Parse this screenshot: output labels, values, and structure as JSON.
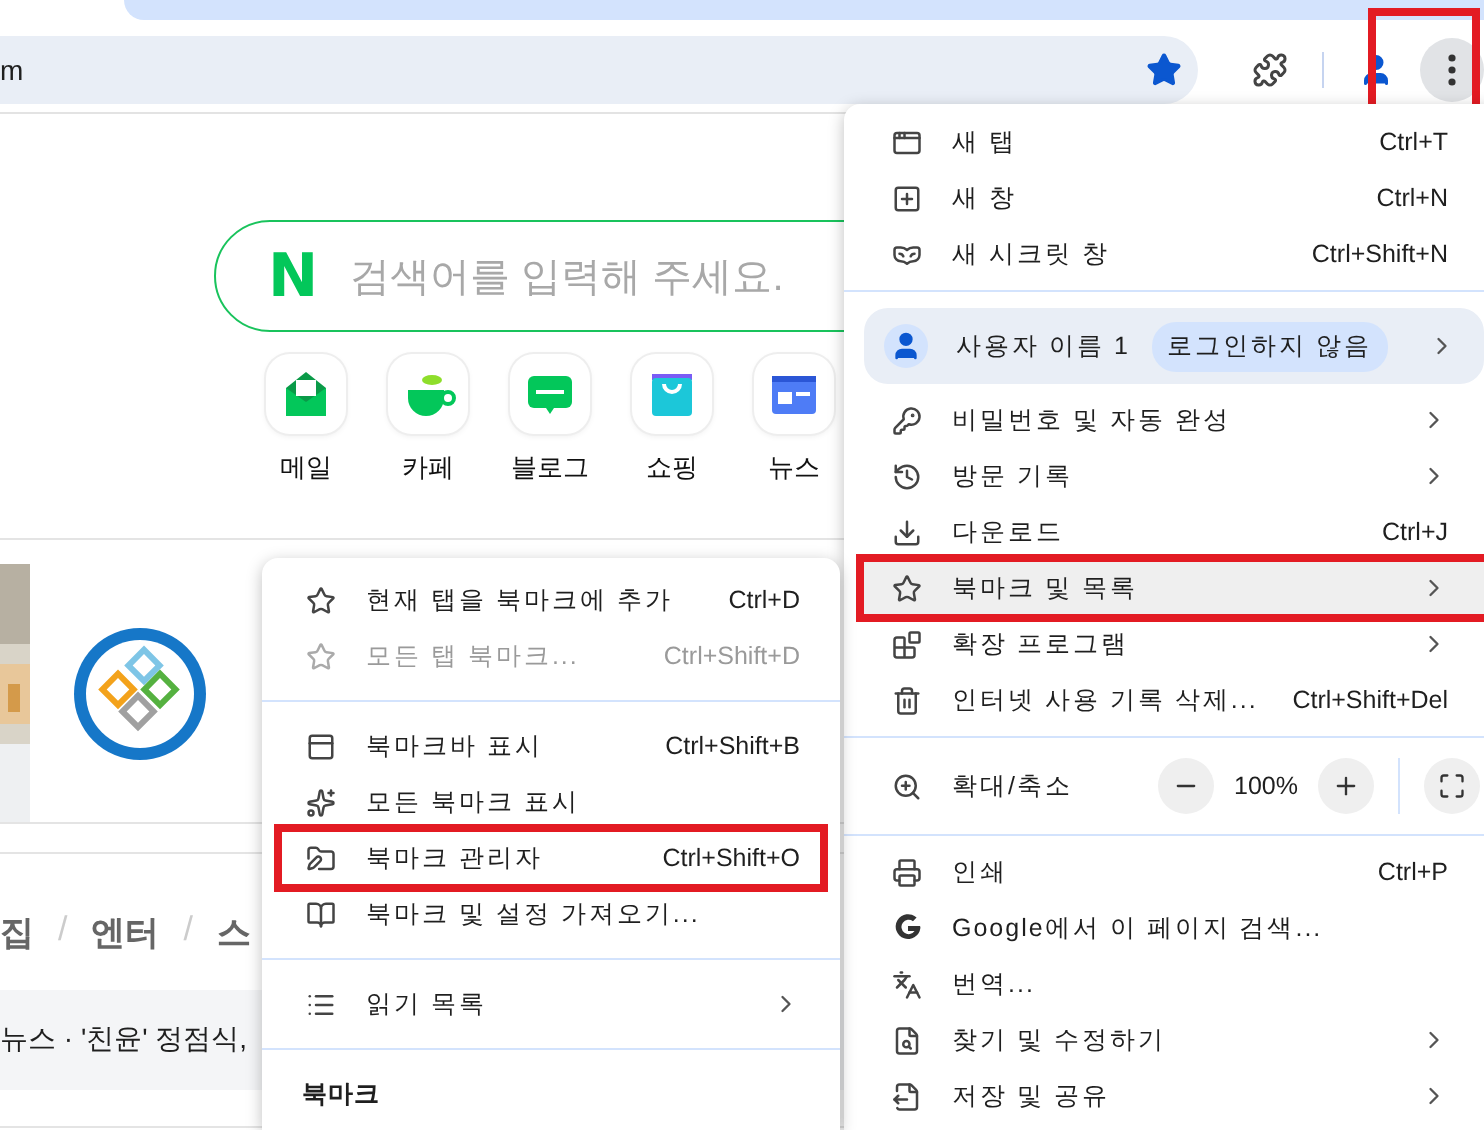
{
  "toolbar": {
    "address": "m",
    "bookmarked": true,
    "menu_highlighted": true
  },
  "page": {
    "search": {
      "logo": "N",
      "placeholder": "검색어를 입력해 주세요."
    },
    "shortcuts": [
      {
        "kind": "mail",
        "label": "메일"
      },
      {
        "kind": "cafe",
        "label": "카페"
      },
      {
        "kind": "blog",
        "label": "블로그"
      },
      {
        "kind": "shopping",
        "label": "쇼핑"
      },
      {
        "kind": "news",
        "label": "뉴스"
      }
    ],
    "nav": [
      "집",
      "/",
      "엔터",
      "/",
      "스"
    ],
    "headline": "뉴스 · '친윤' 정점식,"
  },
  "main_menu": {
    "groups": [
      [
        {
          "kind": "command",
          "label": "새 탭",
          "shortcut": "Ctrl+T",
          "submenu": false,
          "selected": false,
          "highlighted": false
        },
        {
          "kind": "command",
          "label": "새 창",
          "shortcut": "Ctrl+N",
          "submenu": false,
          "selected": false,
          "highlighted": false
        },
        {
          "kind": "command",
          "label": "새 시크릿 창",
          "shortcut": "Ctrl+Shift+N",
          "submenu": false,
          "selected": false,
          "highlighted": false
        }
      ],
      [
        {
          "kind": "profile",
          "label": "사용자 이름 1",
          "badge": "로그인하지 않음",
          "submenu": true
        },
        {
          "kind": "command",
          "label": "비밀번호 및 자동 완성",
          "submenu": true,
          "selected": false,
          "highlighted": false
        },
        {
          "kind": "command",
          "label": "방문 기록",
          "submenu": true,
          "selected": false,
          "highlighted": false
        },
        {
          "kind": "command",
          "label": "다운로드",
          "shortcut": "Ctrl+J",
          "submenu": false,
          "selected": false,
          "highlighted": false
        },
        {
          "kind": "command",
          "label": "북마크 및 목록",
          "submenu": true,
          "selected": true,
          "highlighted": true
        },
        {
          "kind": "command",
          "label": "확장 프로그램",
          "submenu": true,
          "selected": false,
          "highlighted": false
        },
        {
          "kind": "command",
          "label": "인터넷 사용 기록 삭제...",
          "shortcut": "Ctrl+Shift+Del",
          "submenu": false,
          "selected": false,
          "highlighted": false
        }
      ],
      [
        {
          "kind": "zoom",
          "label": "확대/축소",
          "value": "100%"
        }
      ],
      [
        {
          "kind": "command",
          "label": "인쇄",
          "shortcut": "Ctrl+P",
          "submenu": false,
          "selected": false,
          "highlighted": false
        },
        {
          "kind": "command",
          "label": "Google에서 이 페이지 검색...",
          "submenu": false,
          "selected": false,
          "highlighted": false
        },
        {
          "kind": "command",
          "label": "번역...",
          "submenu": false,
          "selected": false,
          "highlighted": false
        },
        {
          "kind": "command",
          "label": "찾기 및 수정하기",
          "submenu": true,
          "selected": false,
          "highlighted": false
        },
        {
          "kind": "command",
          "label": "저장 및 공유",
          "submenu": true,
          "selected": false,
          "highlighted": false
        }
      ]
    ]
  },
  "bookmark_menu": {
    "groups": [
      [
        {
          "label": "현재 탭을 북마크에 추가",
          "shortcut": "Ctrl+D",
          "submenu": false,
          "disabled": false,
          "highlighted": false
        },
        {
          "label": "모든 탭 북마크...",
          "shortcut": "Ctrl+Shift+D",
          "submenu": false,
          "disabled": true,
          "highlighted": false
        }
      ],
      [
        {
          "label": "북마크바 표시",
          "shortcut": "Ctrl+Shift+B",
          "submenu": false,
          "disabled": false,
          "highlighted": false
        },
        {
          "label": "모든 북마크 표시",
          "submenu": false,
          "disabled": false,
          "highlighted": false
        },
        {
          "label": "북마크 관리자",
          "shortcut": "Ctrl+Shift+O",
          "submenu": false,
          "disabled": false,
          "highlighted": true
        },
        {
          "label": "북마크 및 설정 가져오기...",
          "submenu": false,
          "disabled": false,
          "highlighted": false
        }
      ],
      [
        {
          "label": "읽기 목록",
          "submenu": true,
          "disabled": false,
          "highlighted": false
        }
      ]
    ],
    "section_title": "북마크"
  }
}
